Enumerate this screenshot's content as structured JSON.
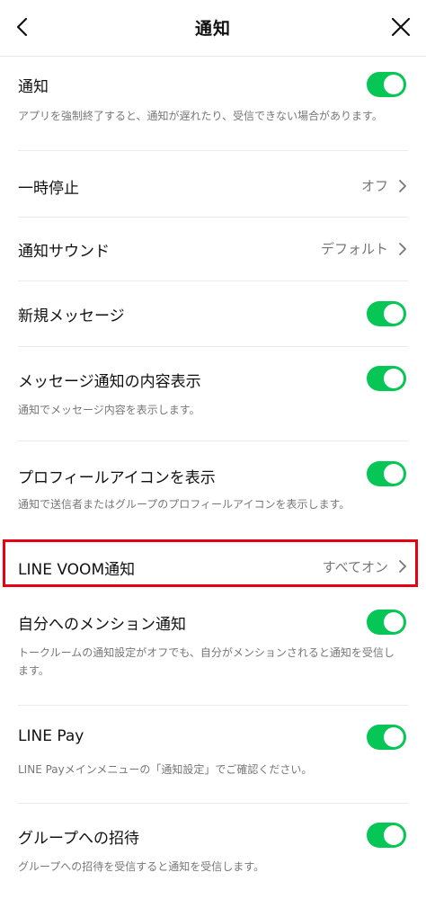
{
  "header": {
    "title": "通知",
    "back_icon": "chevron-left-icon",
    "close_icon": "close-icon"
  },
  "colors": {
    "toggle_on": "#06c755",
    "highlight": "#e60012"
  },
  "settings": {
    "notifications": {
      "label": "通知",
      "description": "アプリを強制終了すると、通知が遅れたり、受信できない場合があります。",
      "state": "on"
    },
    "pause": {
      "label": "一時停止",
      "value": "オフ"
    },
    "sound": {
      "label": "通知サウンド",
      "value": "デフォルト"
    },
    "new_message": {
      "label": "新規メッセージ",
      "state": "on"
    },
    "message_preview": {
      "label": "メッセージ通知の内容表示",
      "description": "通知でメッセージ内容を表示します。",
      "state": "on"
    },
    "profile_icon": {
      "label": "プロフィールアイコンを表示",
      "description": "通知で送信者またはグループのプロフィールアイコンを表示します。",
      "state": "on"
    },
    "line_voom": {
      "label": "LINE VOOM通知",
      "value": "すべてオン"
    },
    "mentions": {
      "label": "自分へのメンション通知",
      "description": "トークルームの通知設定がオフでも、自分がメンションされると通知を受信します。",
      "state": "on"
    },
    "line_pay": {
      "label": "LINE Pay",
      "description": "LINE Payメインメニューの「通知設定」でご確認ください。",
      "state": "on"
    },
    "group_invite": {
      "label": "グループへの招待",
      "description": "グループへの招待を受信すると通知を受信します。",
      "state": "on"
    }
  }
}
